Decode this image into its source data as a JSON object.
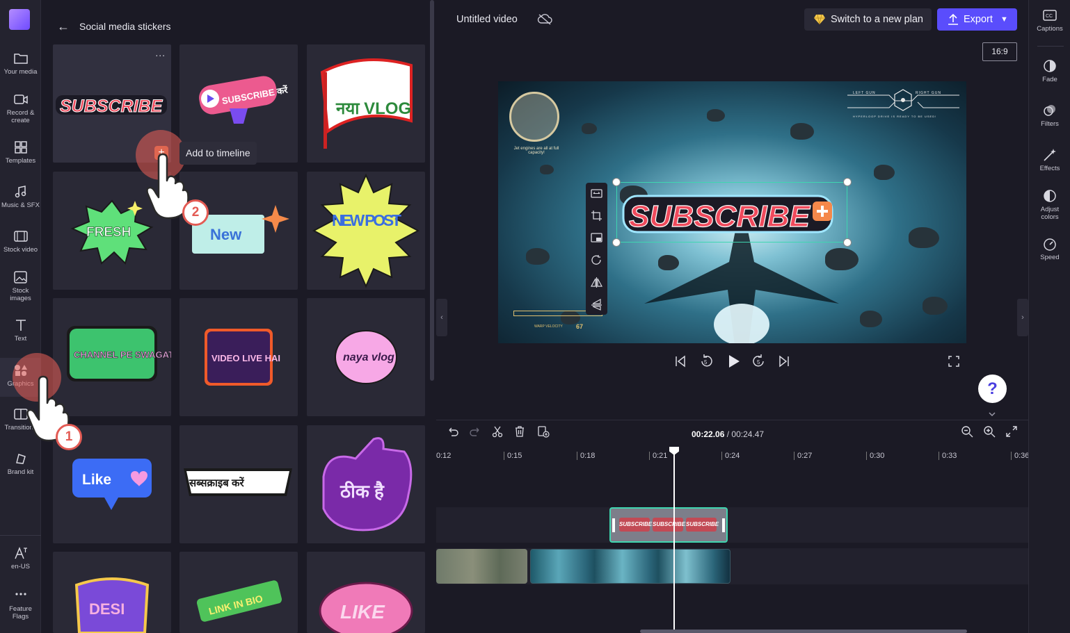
{
  "nav": {
    "items": [
      {
        "label": "Your media",
        "icon": "folder-icon"
      },
      {
        "label": "Record & create",
        "icon": "camera-icon"
      },
      {
        "label": "Templates",
        "icon": "templates-icon"
      },
      {
        "label": "Music & SFX",
        "icon": "music-icon"
      },
      {
        "label": "Stock video",
        "icon": "film-icon"
      },
      {
        "label": "Stock images",
        "icon": "image-icon"
      },
      {
        "label": "Text",
        "icon": "text-icon"
      },
      {
        "label": "Graphics",
        "icon": "shapes-icon"
      },
      {
        "label": "Transitions",
        "icon": "transition-icon"
      },
      {
        "label": "Brand kit",
        "icon": "brand-icon"
      },
      {
        "label": "en-US",
        "icon": "language-icon"
      },
      {
        "label": "Feature Flags",
        "icon": "more-icon"
      }
    ]
  },
  "panel": {
    "title": "Social media stickers",
    "tooltip": "Add to timeline",
    "add_symbol": "+",
    "more": "...",
    "stickers": [
      "SUBSCRIBE",
      "SUBSCRIBE करें",
      "नया VLOG",
      "FRESH",
      "New",
      "NEW POST",
      "CHANNEL PE SWAGAT",
      "VIDEO LIVE HAI",
      "naya vlog",
      "Like",
      "सब्सक्राइब करें",
      "ठीक है",
      "DESI",
      "LINK IN BIO",
      "LIKE"
    ]
  },
  "steps": {
    "one": "1",
    "two": "2"
  },
  "topbar": {
    "title": "Untitled video",
    "plan_button": "Switch to a new plan",
    "export_button": "Export",
    "aspect_ratio": "16:9"
  },
  "preview": {
    "sticker_text": "SUBSCRIBE",
    "hud_left": "LEFT GUN",
    "hud_right": "RIGHT GUN",
    "hud_caption": "HYPERLOOP DRIVE IS READY TO BE USED!",
    "jet_text": "Jet engines are all at full capacity!",
    "warp_label": "WARP VELOCITY",
    "warp_value": "67"
  },
  "help": {
    "label": "?"
  },
  "rightbar": {
    "items": [
      {
        "label": "Captions",
        "icon": "captions-icon"
      },
      {
        "label": "Fade",
        "icon": "fade-icon"
      },
      {
        "label": "Filters",
        "icon": "filters-icon"
      },
      {
        "label": "Effects",
        "icon": "effects-icon"
      },
      {
        "label": "Adjust colors",
        "icon": "adjust-colors-icon"
      },
      {
        "label": "Speed",
        "icon": "speed-icon"
      }
    ]
  },
  "timeline": {
    "current_time": "00:22.06",
    "separator": " / ",
    "total_time": "00:24.47",
    "ticks": [
      "0:12",
      "0:15",
      "0:18",
      "0:21",
      "0:24",
      "0:27",
      "0:30",
      "0:33",
      "0:36"
    ],
    "clip_label": "SUBSCRIBE"
  }
}
